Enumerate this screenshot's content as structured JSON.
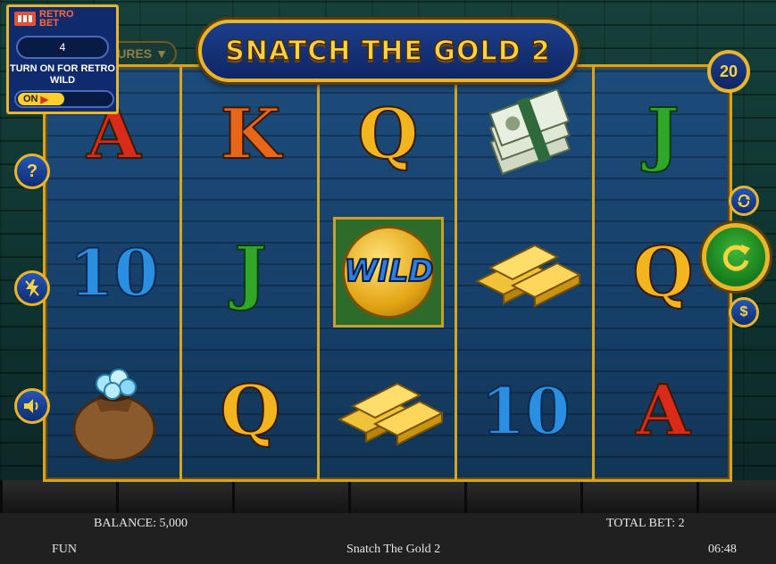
{
  "game": {
    "title": "SNATCH THE GOLD 2",
    "features_label": "URES",
    "lines": "20"
  },
  "retro_panel": {
    "logo_line1": "RETRO",
    "logo_line2": "BET",
    "value": "4",
    "caption": "TURN ON FOR RETRO WILD",
    "toggle_label": "ON"
  },
  "reels": [
    [
      "A",
      "10",
      "money-bag-diamonds"
    ],
    [
      "K",
      "J",
      "Q"
    ],
    [
      "Q",
      "WILD",
      "gold-bars"
    ],
    [
      "cash-stack",
      "gold-bars",
      "10"
    ],
    [
      "J",
      "Q",
      "A"
    ]
  ],
  "side_buttons": [
    "help-icon",
    "turbo-icon",
    "sound-icon"
  ],
  "right_buttons": [
    "autoplay-icon",
    "spin-icon",
    "coin-icon"
  ],
  "colors": {
    "A": "#d92a1a",
    "K": "#e8661a",
    "Q": "#f2b51e",
    "J": "#2fa82a",
    "10": "#2a8fe0",
    "gold": "#e9b62b"
  },
  "status": {
    "balance": "BALANCE: 5,000",
    "total_bet": "TOTAL BET: 2",
    "mode": "FUN",
    "game_name": "Snatch The Gold 2",
    "clock": "06:48"
  }
}
